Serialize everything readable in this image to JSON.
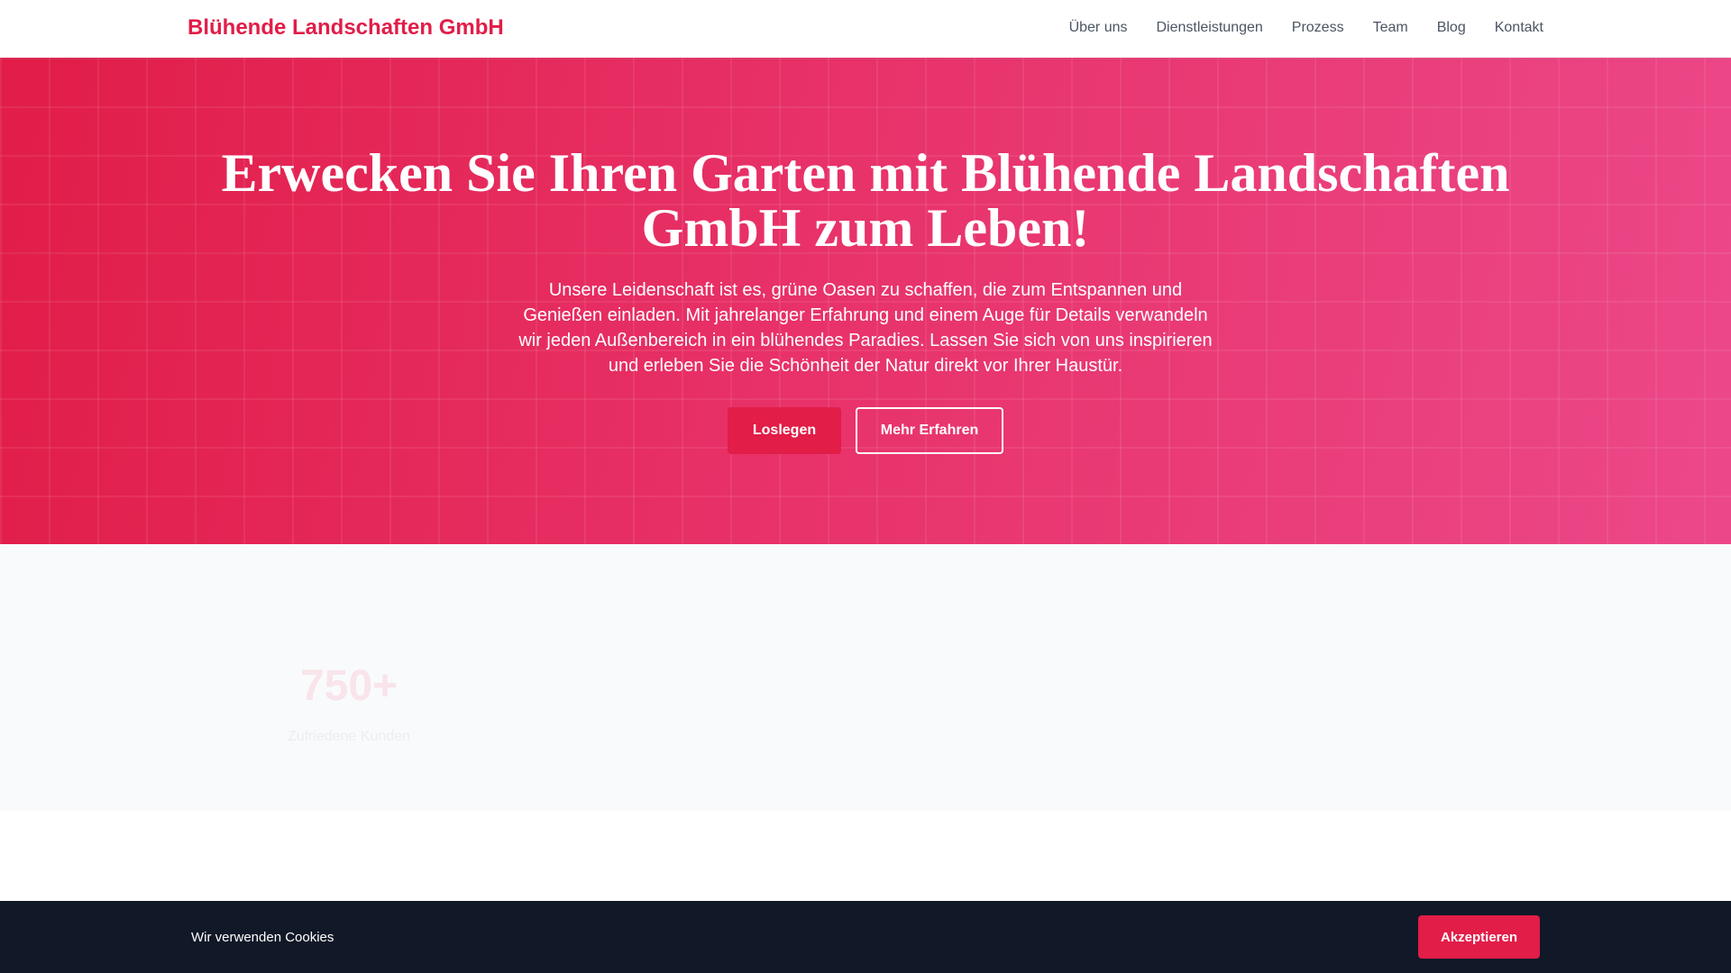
{
  "header": {
    "logo": "Blühende Landschaften GmbH",
    "nav": [
      "Über uns",
      "Dienstleistungen",
      "Prozess",
      "Team",
      "Blog",
      "Kontakt"
    ]
  },
  "hero": {
    "title": "Erwecken Sie Ihren Garten mit Blühende Landschaften GmbH zum Leben!",
    "text": "Unsere Leidenschaft ist es, grüne Oasen zu schaffen, die zum Entspannen und Genießen einladen. Mit jahrelanger Erfahrung und einem Auge für Details verwandeln wir jeden Außenbereich in ein blühendes Paradies. Lassen Sie sich von uns inspirieren und erleben Sie die Schönheit der Natur direkt vor Ihrer Haustür.",
    "primary_button": "Loslegen",
    "secondary_button": "Mehr Erfahren"
  },
  "stats": [
    {
      "value": "750+",
      "label": "Zufriedene Kunden"
    }
  ],
  "cookie": {
    "text": "Wir verwenden Cookies",
    "accept": "Akzeptieren"
  },
  "colors": {
    "accent": "#e11d48",
    "footer": "#111827"
  }
}
